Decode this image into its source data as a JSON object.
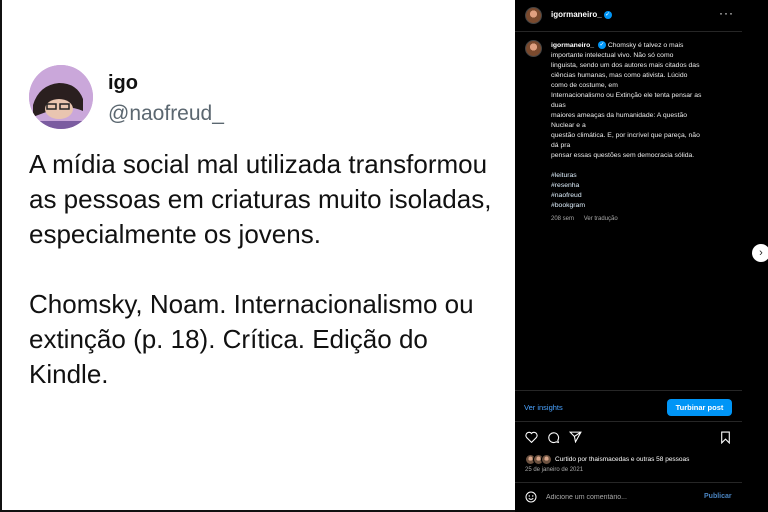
{
  "tweet": {
    "name": "igo",
    "handle": "@naofreud_",
    "paragraph1": "A mídia social mal utilizada transformou as pessoas em criaturas muito isoladas, especialmente os jovens.",
    "paragraph2": "Chomsky, Noam. Internacionalismo ou extinção (p. 18). Crítica. Edição do Kindle."
  },
  "post": {
    "username": "igormaneiro_",
    "more_icon": "more-horizontal-icon",
    "caption_lines": [
      "Chomsky é talvez o mais",
      "importante intelectual vivo. Não só como",
      "linguista, sendo um dos autores mais citados das",
      "ciências humanas, mas como ativista. Lúcido",
      "como de costume, em",
      "Internacionalismo ou Extinção ele tenta pensar as",
      "duas",
      "maiores ameaças da humanidade: A questão",
      "Nuclear e a",
      "questão climática. E, por incrível que pareça, não",
      "dá pra",
      "pensar essas questões sem democracia sólida."
    ],
    "hashtags": [
      "#leituras",
      "#resenha",
      "#naofreud",
      "#bookgram"
    ],
    "age": "208 sem",
    "translate": "Ver tradução",
    "insights": "Ver insights",
    "boost": "Turbinar post",
    "liked_by": "Curtido por thaismacedas e outras 58 pessoas",
    "date": "25 de janeiro de 2021",
    "comment_placeholder": "Adicione um comentário...",
    "publish": "Publicar"
  },
  "colors": {
    "accent": "#0095f6",
    "background": "#000000",
    "muted": "#a8a8a8"
  }
}
